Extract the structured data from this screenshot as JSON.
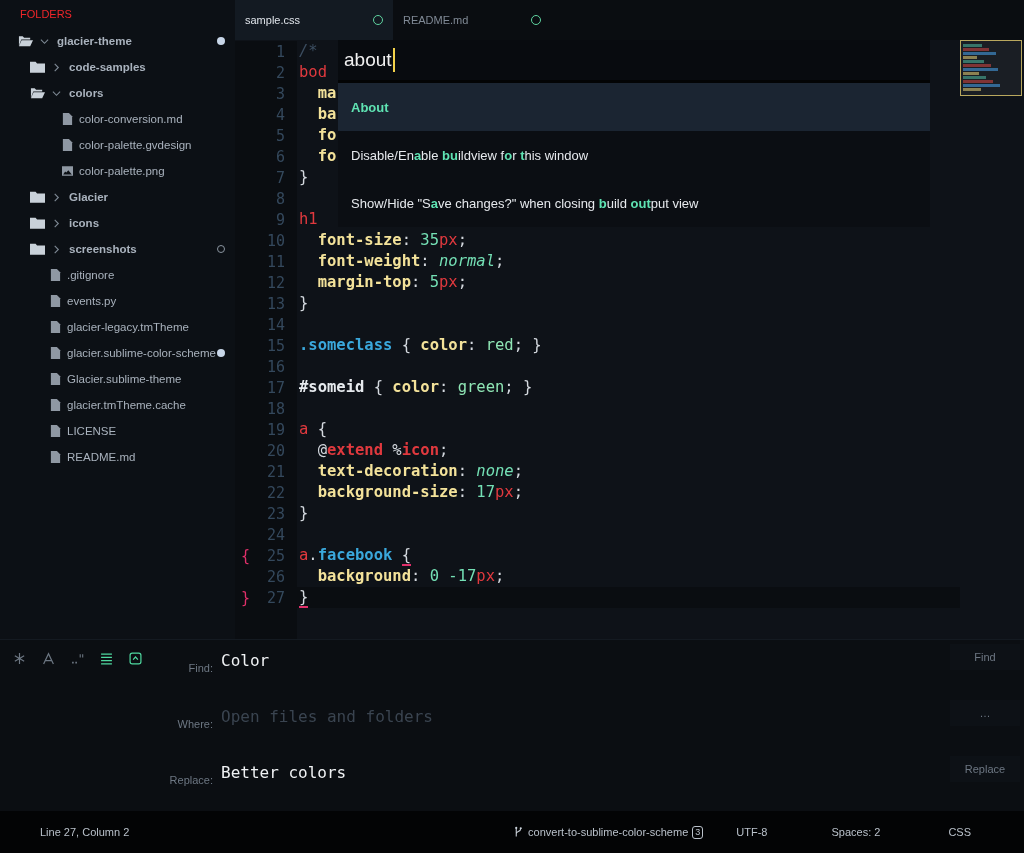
{
  "sidebar": {
    "title": "FOLDERS",
    "items": [
      {
        "kind": "folder",
        "label": "glacier-theme",
        "expanded": true,
        "modified": true,
        "untracked": false,
        "children": [
          {
            "kind": "folder",
            "label": "code-samples",
            "expanded": false,
            "modified": false,
            "untracked": false
          },
          {
            "kind": "folder",
            "label": "colors",
            "expanded": true,
            "modified": false,
            "untracked": false,
            "children": [
              {
                "kind": "file",
                "label": "color-conversion.md",
                "modified": false,
                "untracked": false
              },
              {
                "kind": "file",
                "label": "color-palette.gvdesign",
                "modified": false,
                "untracked": false
              },
              {
                "kind": "image",
                "label": "color-palette.png",
                "modified": false,
                "untracked": false
              }
            ]
          },
          {
            "kind": "folder",
            "label": "Glacier",
            "expanded": false,
            "modified": false,
            "untracked": false
          },
          {
            "kind": "folder",
            "label": "icons",
            "expanded": false,
            "modified": false,
            "untracked": false
          },
          {
            "kind": "folder",
            "label": "screenshots",
            "expanded": false,
            "modified": false,
            "untracked": true
          },
          {
            "kind": "file",
            "label": ".gitignore",
            "modified": false,
            "untracked": false
          },
          {
            "kind": "file",
            "label": "events.py",
            "modified": false,
            "untracked": false
          },
          {
            "kind": "file",
            "label": "glacier-legacy.tmTheme",
            "modified": false,
            "untracked": false
          },
          {
            "kind": "file",
            "label": "glacier.sublime-color-scheme",
            "modified": true,
            "untracked": false
          },
          {
            "kind": "file",
            "label": "Glacier.sublime-theme",
            "modified": false,
            "untracked": false
          },
          {
            "kind": "file",
            "label": "glacier.tmTheme.cache",
            "modified": false,
            "untracked": false
          },
          {
            "kind": "file",
            "label": "LICENSE",
            "modified": false,
            "untracked": false
          },
          {
            "kind": "file",
            "label": "README.md",
            "modified": false,
            "untracked": false
          }
        ]
      }
    ]
  },
  "tabs": [
    {
      "label": "sample.css",
      "selected": true
    },
    {
      "label": "README.md",
      "selected": false
    }
  ],
  "editor": {
    "lines": [
      {
        "number": "1",
        "current": false,
        "tokens": [
          {
            "kind": "comment",
            "text": "/*"
          }
        ]
      },
      {
        "number": "2",
        "current": false,
        "tokens": [
          {
            "kind": "sel",
            "text": "bod"
          }
        ]
      },
      {
        "number": "3",
        "current": false,
        "tokens": [
          {
            "kind": "prop",
            "text": "  ma"
          }
        ]
      },
      {
        "number": "4",
        "current": false,
        "tokens": [
          {
            "kind": "prop",
            "text": "  ba"
          }
        ]
      },
      {
        "number": "5",
        "current": false,
        "tokens": [
          {
            "kind": "prop",
            "text": "  fo"
          }
        ]
      },
      {
        "number": "6",
        "current": false,
        "tokens": [
          {
            "kind": "prop",
            "text": "  fo"
          }
        ]
      },
      {
        "number": "7",
        "current": false,
        "tokens": [
          {
            "kind": "punct",
            "text": "}"
          }
        ]
      },
      {
        "number": "8",
        "current": false
      },
      {
        "number": "9",
        "current": false,
        "tokens": [
          {
            "kind": "sel",
            "text": "h1"
          }
        ]
      },
      {
        "number": "10",
        "current": false,
        "tokens": [
          {
            "kind": "prop",
            "text": "  font-size"
          },
          {
            "kind": "punct",
            "text": ": "
          },
          {
            "kind": "num",
            "text": "35"
          },
          {
            "kind": "unit",
            "text": "px"
          },
          {
            "kind": "punct",
            "text": ";"
          }
        ]
      },
      {
        "number": "11",
        "current": false,
        "tokens": [
          {
            "kind": "prop",
            "text": "  font-weight"
          },
          {
            "kind": "punct",
            "text": ": "
          },
          {
            "kind": "italic",
            "text": "normal"
          },
          {
            "kind": "punct",
            "text": ";"
          }
        ]
      },
      {
        "number": "12",
        "current": false,
        "tokens": [
          {
            "kind": "prop",
            "text": "  margin-top"
          },
          {
            "kind": "punct",
            "text": ": "
          },
          {
            "kind": "num",
            "text": "5"
          },
          {
            "kind": "unit",
            "text": "px"
          },
          {
            "kind": "punct",
            "text": ";"
          }
        ]
      },
      {
        "number": "13",
        "current": false,
        "tokens": [
          {
            "kind": "punct",
            "text": "}"
          }
        ]
      },
      {
        "number": "14",
        "current": false
      },
      {
        "number": "15",
        "current": false,
        "tokens": [
          {
            "kind": "class",
            "text": ".someclass"
          },
          {
            "kind": "punct",
            "text": " { "
          },
          {
            "kind": "prop",
            "text": "color"
          },
          {
            "kind": "punct",
            "text": ": "
          },
          {
            "kind": "val",
            "text": "red"
          },
          {
            "kind": "punct",
            "text": "; }"
          }
        ]
      },
      {
        "number": "16",
        "current": false
      },
      {
        "number": "17",
        "current": false,
        "tokens": [
          {
            "kind": "id",
            "text": "#someid"
          },
          {
            "kind": "punct",
            "text": " { "
          },
          {
            "kind": "prop",
            "text": "color"
          },
          {
            "kind": "punct",
            "text": ": "
          },
          {
            "kind": "val",
            "text": "green"
          },
          {
            "kind": "punct",
            "text": "; }"
          }
        ]
      },
      {
        "number": "18",
        "current": false
      },
      {
        "number": "19",
        "current": false,
        "tokens": [
          {
            "kind": "sel",
            "text": "a"
          },
          {
            "kind": "punct",
            "text": " {"
          }
        ]
      },
      {
        "number": "20",
        "current": false,
        "tokens": [
          {
            "kind": "punct",
            "text": "  @"
          },
          {
            "kind": "at",
            "text": "extend"
          },
          {
            "kind": "punct",
            "text": " %"
          },
          {
            "kind": "at",
            "text": "icon"
          },
          {
            "kind": "punct",
            "text": ";"
          }
        ]
      },
      {
        "number": "21",
        "current": false,
        "tokens": [
          {
            "kind": "prop",
            "text": "  text-decoration"
          },
          {
            "kind": "punct",
            "text": ": "
          },
          {
            "kind": "italic",
            "text": "none"
          },
          {
            "kind": "punct",
            "text": ";"
          }
        ]
      },
      {
        "number": "22",
        "current": false,
        "tokens": [
          {
            "kind": "prop",
            "text": "  background-size"
          },
          {
            "kind": "punct",
            "text": ": "
          },
          {
            "kind": "num",
            "text": "17"
          },
          {
            "kind": "unit",
            "text": "px"
          },
          {
            "kind": "punct",
            "text": ";"
          }
        ]
      },
      {
        "number": "23",
        "current": false,
        "tokens": [
          {
            "kind": "punct",
            "text": "}"
          }
        ]
      },
      {
        "number": "24",
        "current": false
      },
      {
        "number": "25",
        "current": false,
        "marker": "{",
        "tokens": [
          {
            "kind": "sel",
            "text": "a"
          },
          {
            "kind": "punct",
            "text": "."
          },
          {
            "kind": "class",
            "text": "facebook "
          },
          {
            "kind": "brace",
            "text": "{"
          }
        ]
      },
      {
        "number": "26",
        "current": false,
        "tokens": [
          {
            "kind": "prop",
            "text": "  background"
          },
          {
            "kind": "punct",
            "text": ": "
          },
          {
            "kind": "num",
            "text": "0 -17"
          },
          {
            "kind": "unit",
            "text": "px"
          },
          {
            "kind": "punct",
            "text": ";"
          }
        ]
      },
      {
        "number": "27",
        "current": true,
        "marker": "}",
        "tokens": [
          {
            "kind": "brace",
            "text": "}"
          }
        ]
      }
    ]
  },
  "palette": {
    "query": "about",
    "items": [
      {
        "label": "About",
        "selected": true
      },
      {
        "label": "Disable/En**a**ble **bu**ildview f**o**r **t**his window",
        "selected": false
      },
      {
        "label": "Show/Hide \"S**a**ve changes?\" when closing **b**uild **out**put view",
        "selected": false
      }
    ]
  },
  "find_panel": {
    "toggles": [
      {
        "kind": "regex",
        "on": false
      },
      {
        "kind": "case",
        "on": false
      },
      {
        "kind": "word",
        "on": false
      },
      {
        "kind": "context",
        "on": true
      },
      {
        "kind": "highlight",
        "on": true
      }
    ],
    "rows": [
      {
        "label": "Find:",
        "value": "Color",
        "button": "Find"
      },
      {
        "label": "Where:",
        "placeholder": "Open files and folders",
        "button": "…"
      },
      {
        "label": "Replace:",
        "value": "Better colors",
        "button": "Replace"
      }
    ]
  },
  "status_bar": {
    "position": "Line 27, Column 2",
    "branch": "convert-to-sublime-color-scheme",
    "branch_count": "3",
    "encoding": "UTF-8",
    "indentation": "Spaces: 2",
    "syntax": "CSS"
  }
}
